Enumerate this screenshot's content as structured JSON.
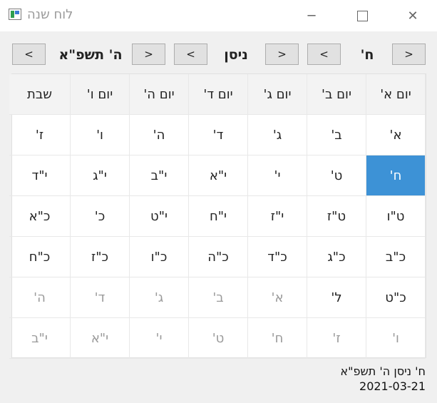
{
  "window": {
    "title": "לוח שנה",
    "minimize": "─",
    "close": "✕"
  },
  "nav": {
    "day": {
      "label": "ח'",
      "prev": "<",
      "next": ">"
    },
    "month": {
      "label": "ניסן",
      "prev": "<",
      "next": ">"
    },
    "year": {
      "label": "ה' תשפ\"א",
      "prev": "<",
      "next": ">"
    }
  },
  "calendar": {
    "headers": [
      "יום א'",
      "יום ב'",
      "יום ג'",
      "יום ד'",
      "יום ה'",
      "יום ו'",
      "שבת"
    ],
    "weeks": [
      [
        {
          "t": "א'"
        },
        {
          "t": "ב'"
        },
        {
          "t": "ג'"
        },
        {
          "t": "ד'"
        },
        {
          "t": "ה'"
        },
        {
          "t": "ו'"
        },
        {
          "t": "ז'"
        }
      ],
      [
        {
          "t": "ח'",
          "selected": true
        },
        {
          "t": "ט'"
        },
        {
          "t": "י'"
        },
        {
          "t": "י\"א"
        },
        {
          "t": "י\"ב"
        },
        {
          "t": "י\"ג"
        },
        {
          "t": "י\"ד"
        }
      ],
      [
        {
          "t": "ט\"ו"
        },
        {
          "t": "ט\"ז"
        },
        {
          "t": "י\"ז"
        },
        {
          "t": "י\"ח"
        },
        {
          "t": "י\"ט"
        },
        {
          "t": "כ'"
        },
        {
          "t": "כ\"א"
        }
      ],
      [
        {
          "t": "כ\"ב"
        },
        {
          "t": "כ\"ג"
        },
        {
          "t": "כ\"ד"
        },
        {
          "t": "כ\"ה"
        },
        {
          "t": "כ\"ו"
        },
        {
          "t": "כ\"ז"
        },
        {
          "t": "כ\"ח"
        }
      ],
      [
        {
          "t": "כ\"ט"
        },
        {
          "t": "ל'"
        },
        {
          "t": "א'",
          "dim": true
        },
        {
          "t": "ב'",
          "dim": true
        },
        {
          "t": "ג'",
          "dim": true
        },
        {
          "t": "ד'",
          "dim": true
        },
        {
          "t": "ה'",
          "dim": true
        }
      ],
      [
        {
          "t": "ו'",
          "dim": true
        },
        {
          "t": "ז'",
          "dim": true
        },
        {
          "t": "ח'",
          "dim": true
        },
        {
          "t": "ט'",
          "dim": true
        },
        {
          "t": "י'",
          "dim": true
        },
        {
          "t": "י\"א",
          "dim": true
        },
        {
          "t": "י\"ב",
          "dim": true
        }
      ]
    ],
    "selected_color": "#3d92d6"
  },
  "footer": {
    "hebrew_date": "ח' ניסן ה' תשפ\"א",
    "gregorian_date": "2021-03-21"
  }
}
